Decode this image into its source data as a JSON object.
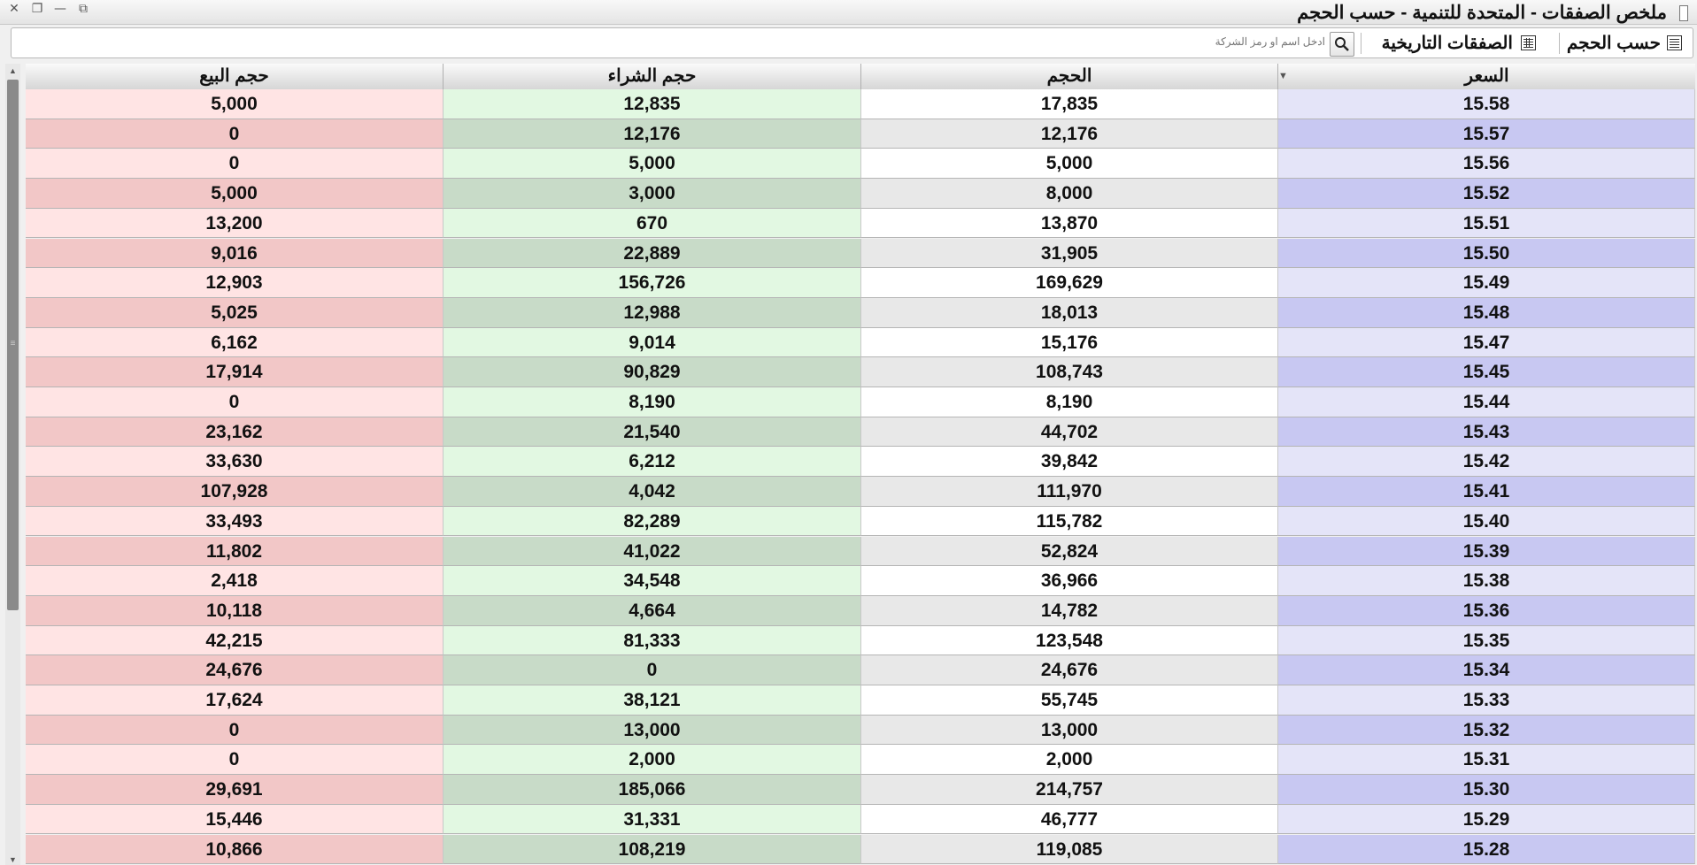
{
  "window": {
    "title": "ملخص الصفقات - المتحدة للتنمية - حسب الحجم",
    "controls": {
      "close": "✕",
      "restore": "❐",
      "minimize": "—",
      "popout": "⧉"
    }
  },
  "toolbar": {
    "by_volume_label": "حسب الحجم",
    "historical_label": "الصفقات التاريخية",
    "search_placeholder": "ادخل اسم او رمز الشركة",
    "icons": {
      "by_volume": "table-icon",
      "historical": "calendar-icon",
      "search": "search-icon"
    }
  },
  "table": {
    "columns": {
      "price": "السعر",
      "volume": "الحجم",
      "buy_volume": "حجم الشراء",
      "sell_volume": "حجم البيع"
    },
    "sorted_column": "price",
    "sort_direction": "descending",
    "rows": [
      {
        "price": "15.58",
        "volume": "17,835",
        "buy": "12,835",
        "sell": "5,000"
      },
      {
        "price": "15.57",
        "volume": "12,176",
        "buy": "12,176",
        "sell": "0"
      },
      {
        "price": "15.56",
        "volume": "5,000",
        "buy": "5,000",
        "sell": "0"
      },
      {
        "price": "15.52",
        "volume": "8,000",
        "buy": "3,000",
        "sell": "5,000"
      },
      {
        "price": "15.51",
        "volume": "13,870",
        "buy": "670",
        "sell": "13,200"
      },
      {
        "price": "15.50",
        "volume": "31,905",
        "buy": "22,889",
        "sell": "9,016"
      },
      {
        "price": "15.49",
        "volume": "169,629",
        "buy": "156,726",
        "sell": "12,903"
      },
      {
        "price": "15.48",
        "volume": "18,013",
        "buy": "12,988",
        "sell": "5,025"
      },
      {
        "price": "15.47",
        "volume": "15,176",
        "buy": "9,014",
        "sell": "6,162"
      },
      {
        "price": "15.45",
        "volume": "108,743",
        "buy": "90,829",
        "sell": "17,914"
      },
      {
        "price": "15.44",
        "volume": "8,190",
        "buy": "8,190",
        "sell": "0"
      },
      {
        "price": "15.43",
        "volume": "44,702",
        "buy": "21,540",
        "sell": "23,162"
      },
      {
        "price": "15.42",
        "volume": "39,842",
        "buy": "6,212",
        "sell": "33,630"
      },
      {
        "price": "15.41",
        "volume": "111,970",
        "buy": "4,042",
        "sell": "107,928"
      },
      {
        "price": "15.40",
        "volume": "115,782",
        "buy": "82,289",
        "sell": "33,493"
      },
      {
        "price": "15.39",
        "volume": "52,824",
        "buy": "41,022",
        "sell": "11,802"
      },
      {
        "price": "15.38",
        "volume": "36,966",
        "buy": "34,548",
        "sell": "2,418"
      },
      {
        "price": "15.36",
        "volume": "14,782",
        "buy": "4,664",
        "sell": "10,118"
      },
      {
        "price": "15.35",
        "volume": "123,548",
        "buy": "81,333",
        "sell": "42,215"
      },
      {
        "price": "15.34",
        "volume": "24,676",
        "buy": "0",
        "sell": "24,676"
      },
      {
        "price": "15.33",
        "volume": "55,745",
        "buy": "38,121",
        "sell": "17,624"
      },
      {
        "price": "15.32",
        "volume": "13,000",
        "buy": "13,000",
        "sell": "0"
      },
      {
        "price": "15.31",
        "volume": "2,000",
        "buy": "2,000",
        "sell": "0"
      },
      {
        "price": "15.30",
        "volume": "214,757",
        "buy": "185,066",
        "sell": "29,691"
      },
      {
        "price": "15.29",
        "volume": "46,777",
        "buy": "31,331",
        "sell": "15,446"
      },
      {
        "price": "15.28",
        "volume": "119,085",
        "buy": "108,219",
        "sell": "10,866"
      }
    ]
  },
  "colors": {
    "price_bg": "#e4e4f8",
    "price_bg_alt": "#c8c8f2",
    "volume_bg": "#ffffff",
    "volume_bg_alt": "#e8e8e8",
    "buy_bg": "#e2f8e2",
    "buy_bg_alt": "#c8dbc8",
    "sell_bg": "#ffe4e4",
    "sell_bg_alt": "#f2c7c7"
  }
}
